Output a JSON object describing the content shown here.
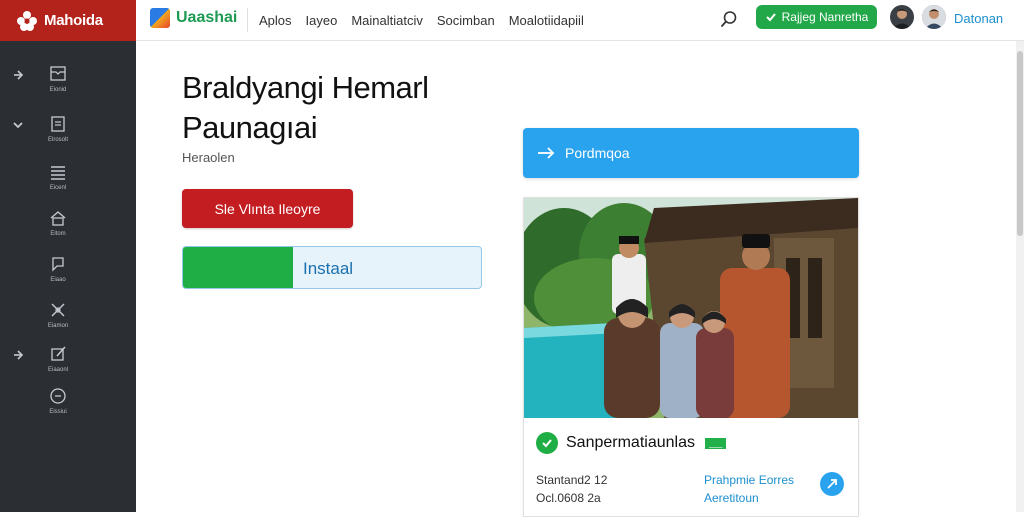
{
  "header": {
    "brand_name": "Mahoida",
    "app_name": "Uaashai",
    "nav": [
      "Aplos",
      "Iayeo",
      "Mainaltiatciv",
      "Socimban",
      "Moalotiidapiil"
    ],
    "register_label": "Rajjeg Nanretha",
    "username": "Datonan",
    "icons": {
      "search": "search-icon",
      "register": "check-icon"
    }
  },
  "sidebar": {
    "items": [
      {
        "label": "Eionid",
        "icon": "inbox-icon",
        "arrow": "arrow-right"
      },
      {
        "label": "Elrosolt",
        "icon": "clipboard-icon",
        "arrow": "chevron-down"
      },
      {
        "label": "Eicenl",
        "icon": "list-icon",
        "arrow": ""
      },
      {
        "label": "Eitom",
        "icon": "home-icon",
        "arrow": ""
      },
      {
        "label": "Eiaao",
        "icon": "chat-icon",
        "arrow": ""
      },
      {
        "label": "Eiamon",
        "icon": "tools-icon",
        "arrow": ""
      },
      {
        "label": "Eiaaonl",
        "icon": "edit-icon",
        "arrow": "arrow-right"
      },
      {
        "label": "Eissiui",
        "icon": "help-icon",
        "arrow": ""
      }
    ]
  },
  "main": {
    "title_line1": "Braldyangi Hemarl",
    "title_line2": "Paunagıai",
    "subtitle": "Heraolen",
    "red_button": "Sle Vlınta Ileoyre",
    "install_label": "Instaal",
    "install_progress": 0.37,
    "blue_button": "Pordmqoa",
    "card": {
      "title": "Sanpermatiaunlas",
      "tag": "___",
      "meta_left": [
        "Stantand2 12",
        "Ocl.0608 2a"
      ],
      "meta_right": [
        "Prahpmie Eorres",
        "Aeretitoun"
      ]
    }
  },
  "colors": {
    "brand_red": "#b3231b",
    "sidebar_bg": "#2b2f34",
    "green": "#1fae45",
    "blue": "#2aa3ef",
    "red_button": "#c31d22",
    "link_blue": "#1d8fcf"
  }
}
